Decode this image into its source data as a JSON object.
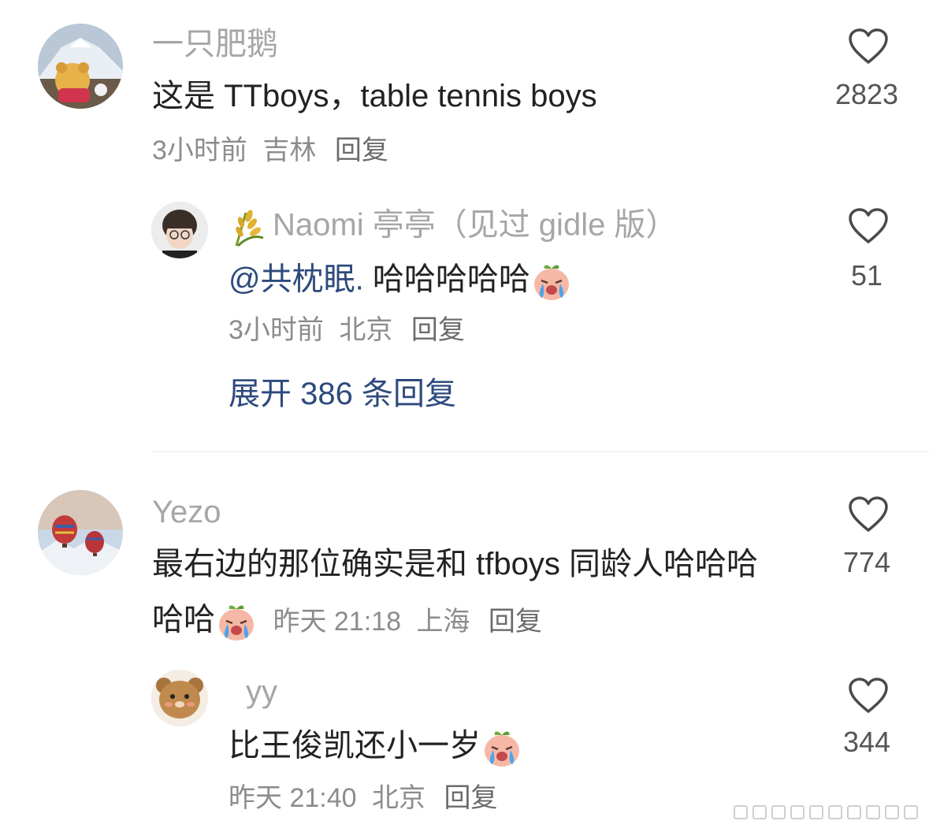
{
  "comments": [
    {
      "username": "一只肥鹅",
      "text": "这是 TTboys，table tennis boys",
      "time": "3小时前",
      "location": "吉林",
      "reply_label": "回复",
      "likes": "2823",
      "avatar_icon": "winnie-pooh-avatar",
      "replies": [
        {
          "username": "Naomi 亭亭（见过 gidle 版）",
          "badge_icon": "rice-ear-icon",
          "mention": "@共枕眠.",
          "text": " 哈哈哈哈哈",
          "emoji": "crying-peach-emoji",
          "time": "3小时前",
          "location": "北京",
          "reply_label": "回复",
          "likes": "51",
          "avatar_icon": "boy-with-glasses-avatar"
        }
      ],
      "expand_label": "展开 386 条回复"
    },
    {
      "username": "Yezo",
      "text_line1": "最右边的那位确实是和 tfboys 同龄人哈哈哈",
      "text_line2": "哈哈",
      "emoji": "crying-peach-emoji",
      "time": "昨天 21:18",
      "location": "上海",
      "reply_label": "回复",
      "likes": "774",
      "avatar_icon": "hot-air-balloon-avatar",
      "replies": [
        {
          "username": "yy",
          "text": "比王俊凯还小一岁",
          "emoji": "crying-peach-emoji",
          "time": "昨天 21:40",
          "location": "北京",
          "reply_label": "回复",
          "likes": "344",
          "avatar_icon": "teddy-bear-avatar"
        }
      ]
    }
  ],
  "colors": {
    "name": "#a6a6a6",
    "text": "#222222",
    "meta": "#8c8c8c",
    "link": "#2e4a7d"
  }
}
